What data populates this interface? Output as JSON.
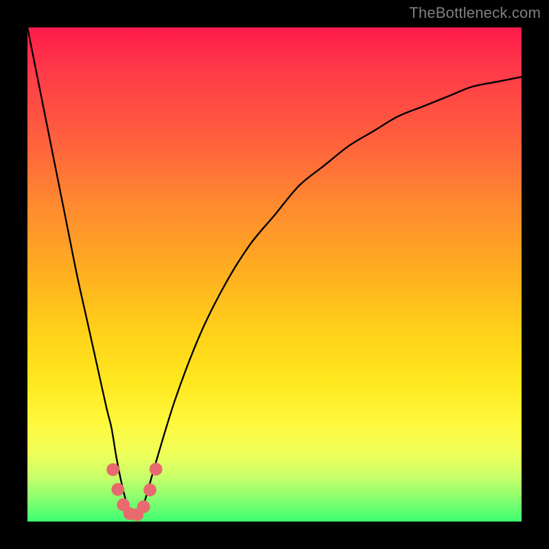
{
  "watermark": "TheBottleneck.com",
  "chart_data": {
    "type": "line",
    "title": "",
    "xlabel": "",
    "ylabel": "",
    "xlim": [
      0,
      100
    ],
    "ylim": [
      0,
      100
    ],
    "grid": false,
    "legend": false,
    "series": [
      {
        "name": "bottleneck-curve",
        "x": [
          0,
          2,
          4,
          6,
          8,
          10,
          12,
          14,
          16,
          17,
          18,
          19,
          20,
          21,
          22,
          23,
          24,
          26,
          30,
          35,
          40,
          45,
          50,
          55,
          60,
          65,
          70,
          75,
          80,
          85,
          90,
          95,
          100
        ],
        "y": [
          100,
          90,
          80,
          70,
          60,
          50,
          41,
          32,
          23,
          19,
          13,
          8,
          4,
          2,
          1,
          2,
          5,
          12,
          25,
          38,
          48,
          56,
          62,
          68,
          72,
          76,
          79,
          82,
          84,
          86,
          88,
          89,
          90
        ]
      }
    ],
    "markers": {
      "name": "highlighted-points",
      "color": "#e86a6f",
      "radius_pct": 1.3,
      "points": [
        {
          "x": 17.3,
          "y": 10.5
        },
        {
          "x": 18.3,
          "y": 6.5
        },
        {
          "x": 19.4,
          "y": 3.4
        },
        {
          "x": 20.7,
          "y": 1.6
        },
        {
          "x": 22.2,
          "y": 1.4
        },
        {
          "x": 23.5,
          "y": 3.0
        },
        {
          "x": 24.8,
          "y": 6.4
        },
        {
          "x": 26.0,
          "y": 10.6
        }
      ]
    }
  }
}
